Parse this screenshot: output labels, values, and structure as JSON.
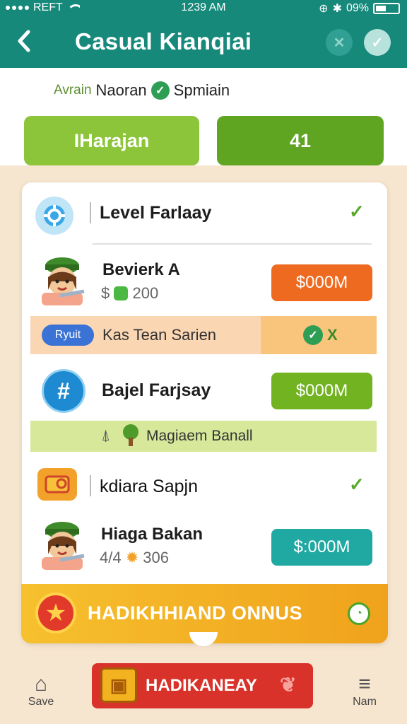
{
  "status": {
    "carrier": "REFT",
    "time": "1239 AM",
    "battery": "09%"
  },
  "header": {
    "title": "Casual Kianqiai",
    "back_icon": "chevron-left-icon",
    "close_icon": "close-icon",
    "confirm_icon": "check-icon"
  },
  "subbar": {
    "user_label": "Avrain",
    "user_name": "Naoran",
    "user_status": "Spmiain",
    "pill_left": "IHarajan",
    "pill_right": "41"
  },
  "sections": [
    {
      "title": "Level Farlaay",
      "icon": "gear-icon",
      "icon_color": "#3aa7e6"
    },
    {
      "title": "Bajel Farjsay",
      "icon": "hashtag-icon",
      "icon_color": "#1d8ad1"
    },
    {
      "title": "kdiara Sapjn",
      "icon": "ticket-icon",
      "icon_color": "#f2a22a"
    }
  ],
  "players": [
    {
      "name": "Bevierk A",
      "score_prefix": "$",
      "score": "200",
      "price": "$000M",
      "price_color": "#ee6a21"
    },
    {
      "name": "Hiaga Bakan",
      "score_prefix": "4/4",
      "score": "306",
      "price": "$:000M",
      "price_color": "#20a9a3"
    }
  ],
  "strips": {
    "orange": {
      "badge": "Ryuit",
      "text": "Kas Tean Sarien",
      "action": "X"
    },
    "green_price": "$000M",
    "green": {
      "text": "Magiaem Banall"
    }
  },
  "bonus": {
    "label": "HADIKHHIAND ONNUS"
  },
  "bottom": {
    "left_label": "Save",
    "center_label": "HADIKANEAY",
    "right_label": "Nam"
  },
  "colors": {
    "teal": "#16897b",
    "green": "#8cc43a",
    "dark_green": "#5fa522",
    "orange": "#ee6a21",
    "red": "#d9322a"
  }
}
